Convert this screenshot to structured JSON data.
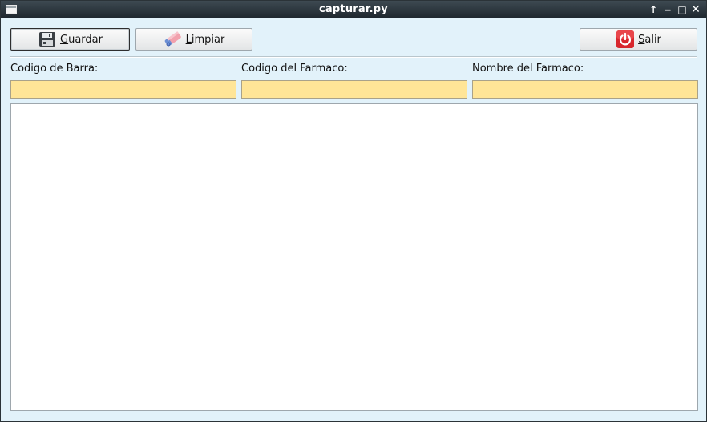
{
  "window": {
    "title": "capturar.py",
    "controls": {
      "up": "↑",
      "minimize": "‒",
      "maximize": "□",
      "close": "✕"
    }
  },
  "toolbar": {
    "guardar": {
      "label_first": "G",
      "label_rest": "uardar",
      "icon": "floppy-disk-icon"
    },
    "limpiar": {
      "label_first": "L",
      "label_rest": "impiar",
      "icon": "eraser-icon"
    },
    "salir": {
      "label_first": "S",
      "label_rest": "alir",
      "icon": "power-icon"
    }
  },
  "form": {
    "codigo_barra": {
      "label": "Codigo de Barra:",
      "value": ""
    },
    "codigo_farmaco": {
      "label": "Codigo del Farmaco:",
      "value": ""
    },
    "nombre_farmaco": {
      "label": "Nombre del Farmaco:",
      "value": ""
    }
  },
  "colors": {
    "window_bg": "#e2f2fa",
    "input_bg": "#ffe597",
    "titlebar": "#1d262d",
    "power_red": "#d8262c"
  }
}
